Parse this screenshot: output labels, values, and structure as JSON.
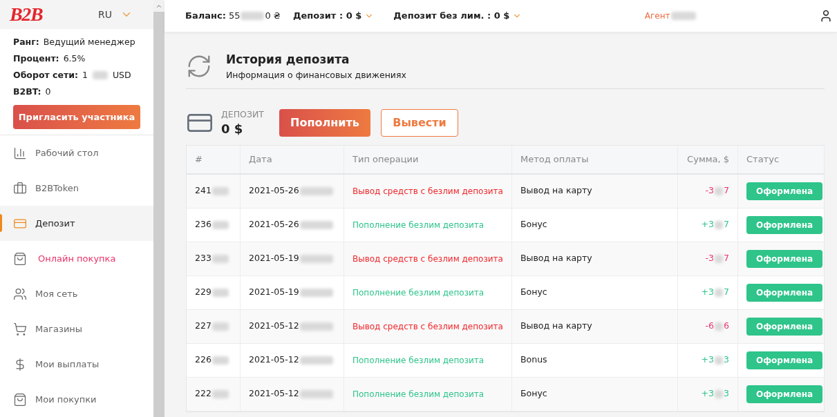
{
  "sidebar": {
    "logo": "B2B",
    "language": "RU",
    "info": [
      {
        "label": "Ранг:",
        "value": "Ведущий менеджер"
      },
      {
        "label": "Процент:",
        "value": "6.5%"
      },
      {
        "label": "Оборот сети:",
        "value": "1",
        "value_end": "USD"
      },
      {
        "label": "B2BT:",
        "value": "0"
      }
    ],
    "invite_button": "Пригласить участника",
    "items": [
      {
        "label": "Рабочий стол",
        "selected": false,
        "highlight": false
      },
      {
        "label": "B2BToken",
        "selected": false,
        "highlight": false
      },
      {
        "label": "Депозит",
        "selected": true,
        "highlight": false
      },
      {
        "label": "Онлайн покупка",
        "selected": false,
        "highlight": true
      },
      {
        "label": "Моя сеть",
        "selected": false,
        "highlight": false
      },
      {
        "label": "Магазины",
        "selected": false,
        "highlight": false
      },
      {
        "label": "Мои выплаты",
        "selected": false,
        "highlight": false
      },
      {
        "label": "Мои покупки",
        "selected": false,
        "highlight": false
      }
    ]
  },
  "header": {
    "balance_label": "Баланс:",
    "balance_start": "55",
    "balance_end": "0 ₴",
    "deposit": "Депозит : 0 $",
    "deposit_unlim": "Депозит без лим. : 0 $",
    "agent": "Агент"
  },
  "page": {
    "title": "История депозита",
    "subtitle": "Информация о финансовых движениях",
    "deposit_label": "ДЕПОЗИТ",
    "deposit_value": "0 $",
    "topup_button": "Пополнить",
    "withdraw_button": "Вывести"
  },
  "table": {
    "columns": [
      "#",
      "Дата",
      "Тип операции",
      "Метод оплаты",
      "Сумма, $",
      "Статус"
    ],
    "rows": [
      {
        "id": "241",
        "date": "2021-05-26",
        "kind": "withdrawal",
        "type": "Вывод средств с безлим депозита",
        "method": "Вывод на карту",
        "amount_start": "-3",
        "amount_end": "7",
        "status": "Оформлена"
      },
      {
        "id": "236",
        "date": "2021-05-26",
        "kind": "topup",
        "type": "Пополнение безлим депозита",
        "method": "Бонус",
        "amount_start": "+3",
        "amount_end": "7",
        "status": "Оформлена"
      },
      {
        "id": "233",
        "date": "2021-05-19",
        "kind": "withdrawal",
        "type": "Вывод средств с безлим депозита",
        "method": "Вывод на карту",
        "amount_start": "-3",
        "amount_end": "7",
        "status": "Оформлена"
      },
      {
        "id": "229",
        "date": "2021-05-19",
        "kind": "topup",
        "type": "Пополнение безлим депозита",
        "method": "Бонус",
        "amount_start": "+3",
        "amount_end": "7",
        "status": "Оформлена"
      },
      {
        "id": "227",
        "date": "2021-05-12",
        "kind": "withdrawal",
        "type": "Вывод средств с безлим депозита",
        "method": "Вывод на карту",
        "amount_start": "-6",
        "amount_end": "6",
        "status": "Оформлена"
      },
      {
        "id": "226",
        "date": "2021-05-12",
        "kind": "topup",
        "type": "Пополнение безлим депозита",
        "method": "Bonus",
        "amount_start": "+3",
        "amount_end": "3",
        "status": "Оформлена"
      },
      {
        "id": "222",
        "date": "2021-05-12",
        "kind": "topup",
        "type": "Пополнение безлим депозита",
        "method": "Бонус",
        "amount_start": "+3",
        "amount_end": "3",
        "status": "Оформлена"
      }
    ]
  }
}
